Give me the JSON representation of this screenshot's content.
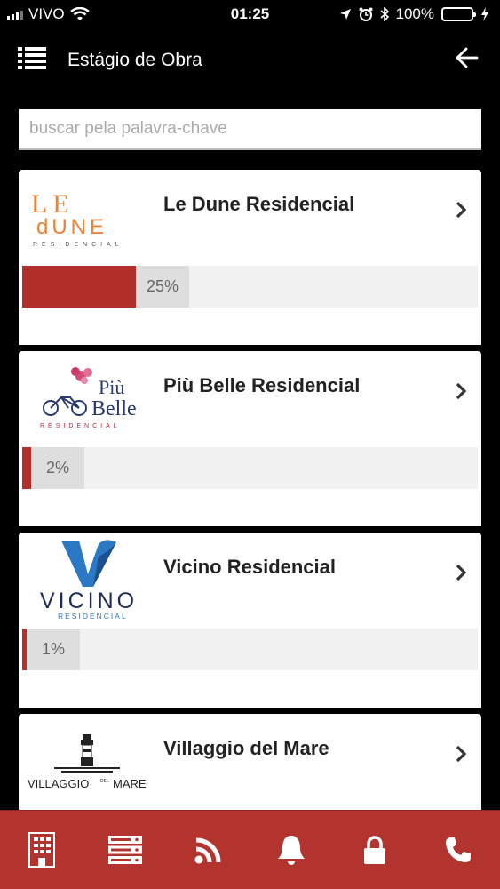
{
  "status_bar": {
    "carrier": "VIVO",
    "time": "01:25",
    "battery": "100%"
  },
  "header": {
    "title": "Estágio de Obra"
  },
  "search": {
    "placeholder": "buscar pela palavra-chave"
  },
  "items": [
    {
      "name": "Le Dune Residencial",
      "progress_percent": 25,
      "progress_label": "25%",
      "logo": {
        "line1": "LE",
        "line2": "dUNE",
        "sub": "RESIDENCIAL"
      }
    },
    {
      "name": "Più Belle Residencial",
      "progress_percent": 2,
      "progress_label": "2%",
      "logo": {
        "line1": "Più",
        "line2": "Belle",
        "sub": "RESIDENCIAL"
      }
    },
    {
      "name": "Vicino Residencial",
      "progress_percent": 1,
      "progress_label": "1%",
      "logo": {
        "line1": "VICINO",
        "sub": "RESIDENCIAL"
      }
    },
    {
      "name": "Villaggio del Mare",
      "logo": {
        "line1": "VILLAGGIO",
        "line2": "DEL",
        "line3": "MARE"
      }
    }
  ],
  "tabbar": [
    "building-icon",
    "server-icon",
    "rss-icon",
    "bell-icon",
    "lock-icon",
    "phone-icon"
  ],
  "colors": {
    "accent": "#b22f2a",
    "tabbar": "#b3342e",
    "progress_bg": "#f1f1f1",
    "label_bg": "#dedede"
  }
}
